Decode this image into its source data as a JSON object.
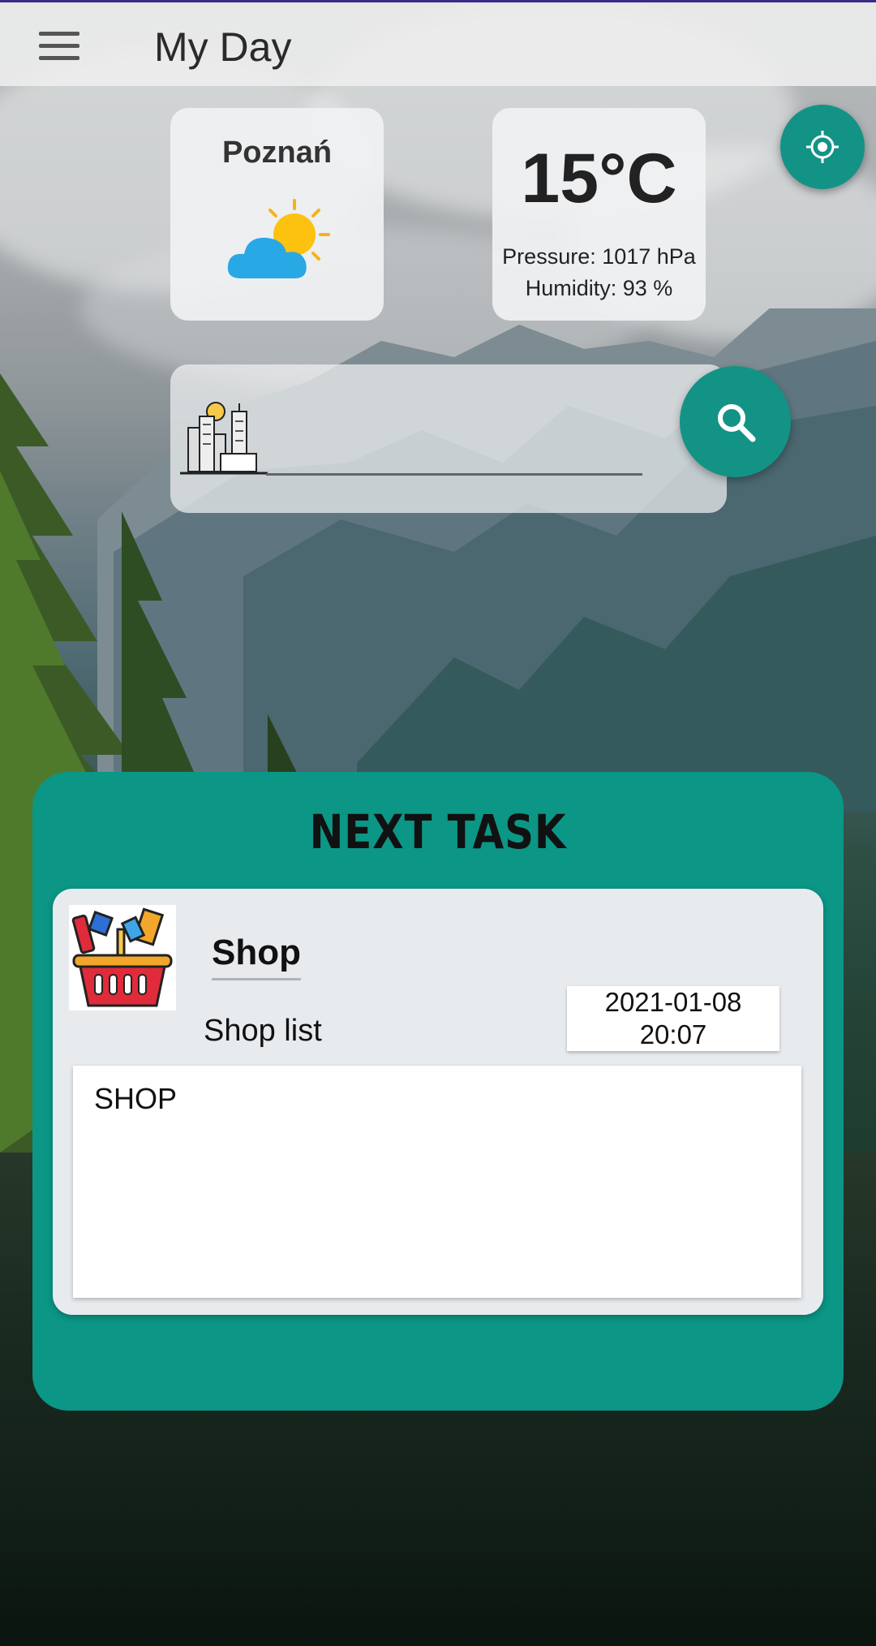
{
  "appbar": {
    "title": "My Day",
    "menu_icon": "hamburger-menu-icon"
  },
  "weather": {
    "city": "Poznań",
    "condition_icon": "partly-cloudy-icon",
    "temperature": "15°C",
    "pressure": "Pressure: 1017 hPa",
    "humidity": "Humidity: 93 %"
  },
  "location_button": {
    "icon": "gps-locate-icon"
  },
  "search": {
    "value": "",
    "icon": "city-buildings-icon",
    "button_icon": "search-icon"
  },
  "next_task": {
    "title": "NEXT TASK",
    "name": "Shop",
    "category": "Shop list",
    "date": "2021-01-08",
    "time": "20:07",
    "description": "SHOP",
    "icon": "shopping-basket-icon"
  },
  "colors": {
    "accent": "#0b9686",
    "appbar": "#eeeeee"
  }
}
